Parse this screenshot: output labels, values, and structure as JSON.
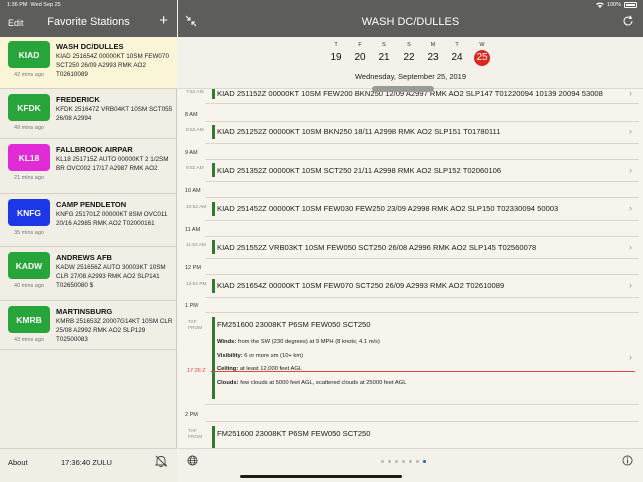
{
  "status": {
    "time": "1:36 PM",
    "date": "Wed Sep 25",
    "battery": "100%"
  },
  "left": {
    "edit_label": "Edit",
    "title": "Favorite Stations",
    "add_label": "+",
    "stations": [
      {
        "code": "KIAD",
        "color": "#27a53a",
        "ago": "42 mins ago",
        "name": "WASH DC/DULLES",
        "metar": "KIAD 251654Z 00000KT 10SM FEW070 SCT250 26/09 A2993 RMK AO2 T02610089",
        "selected": true
      },
      {
        "code": "KFDK",
        "color": "#27a53a",
        "ago": "49 mins ago",
        "name": "FREDERICK",
        "metar": "KFDK 251647Z VRB04KT 10SM SCT055 26/08 A2994"
      },
      {
        "code": "KL18",
        "color": "#e02bd6",
        "ago": "21 mins ago",
        "name": "FALLBROOK AIRPAR",
        "metar": "KL18 251715Z AUTO 00000KT 2 1/2SM BR OVC002 17/17 A2987 RMK AO2"
      },
      {
        "code": "KNFG",
        "color": "#1b37e8",
        "ago": "35 mins ago",
        "name": "CAMP PENDLETON",
        "metar": "KNFG 251701Z 00000KT 8SM OVC011 20/16 A2985 RMK AO2 T02000161"
      },
      {
        "code": "KADW",
        "color": "#27a53a",
        "ago": "40 mins ago",
        "name": "ANDREWS AFB",
        "metar": "KADW 251656Z AUTO 30003KT 10SM CLR 27/08 A2993 RMK AO2 SLP141 T02650080 $"
      },
      {
        "code": "KMRB",
        "color": "#27a53a",
        "ago": "43 mins ago",
        "name": "MARTINSBURG",
        "metar": "KMRB 251653Z 20007G14KT 10SM CLR 25/08 A2992 RMK AO2 SLP129 T02500083"
      }
    ],
    "about_label": "About",
    "zulu_time": "17:36:40 ZULU"
  },
  "right": {
    "title": "WASH DC/DULLES",
    "days": [
      {
        "letter": "T",
        "num": "19"
      },
      {
        "letter": "F",
        "num": "20"
      },
      {
        "letter": "S",
        "num": "21"
      },
      {
        "letter": "S",
        "num": "22"
      },
      {
        "letter": "M",
        "num": "23"
      },
      {
        "letter": "T",
        "num": "24"
      },
      {
        "letter": "W",
        "num": "25",
        "selected": true
      }
    ],
    "full_date": "Wednesday, September 25, 2019",
    "hours": [
      "8 AM",
      "9 AM",
      "10 AM",
      "11 AM",
      "12 PM",
      "1 PM",
      "2 PM"
    ],
    "observations": [
      {
        "time": "7:52 AM",
        "text": "KIAD 251152Z 00000KT 10SM FEW200 BKN250 12/09 A2997 RMK AO2 SLP147 T01220094 10139 20094 53008"
      },
      {
        "time": "8:52 AM",
        "text": "KIAD 251252Z 00000KT 10SM BKN250 18/11 A2998 RMK AO2 SLP151 T01780111"
      },
      {
        "time": "9:52 AM",
        "text": "KIAD 251352Z 00000KT 10SM SCT250 21/11 A2998 RMK AO2 SLP152 T02060106"
      },
      {
        "time": "10:52 AM",
        "text": "KIAD 251452Z 00000KT 10SM FEW030 FEW250 23/09 A2998 RMK AO2 SLP150 T02330094 50003"
      },
      {
        "time": "11:52 AM",
        "text": "KIAD 251552Z VRB03KT 10SM FEW050 SCT250 26/08 A2996 RMK AO2 SLP145 T02560078"
      },
      {
        "time": "12:54 PM",
        "text": "KIAD 251654Z 00000KT 10SM FEW070 SCT250 26/09 A2993 RMK AO2 T02610089"
      }
    ],
    "taf_label_1": "TAF",
    "taf_label_2": "FROM",
    "taf": {
      "text": "FM251600 23008KT P6SM FEW050 SCT250",
      "winds_label": "Winds:",
      "winds": "from the SW (230 degrees) at  9 MPH (8 knots; 4.1 m/s)",
      "visibility_label": "Visibility:",
      "visibility": "6 or more sm (10+ km)",
      "ceiling_label": "Ceiling:",
      "ceiling": "at least 12,000 feet AGL",
      "clouds_label": "Clouds:",
      "clouds": "few clouds at 5000 feet AGL, scattered clouds at 25000 feet AGL"
    },
    "taf2_text": "FM251600 23008KT P6SM FEW050 SCT250",
    "now_time": "17:36 Z"
  }
}
